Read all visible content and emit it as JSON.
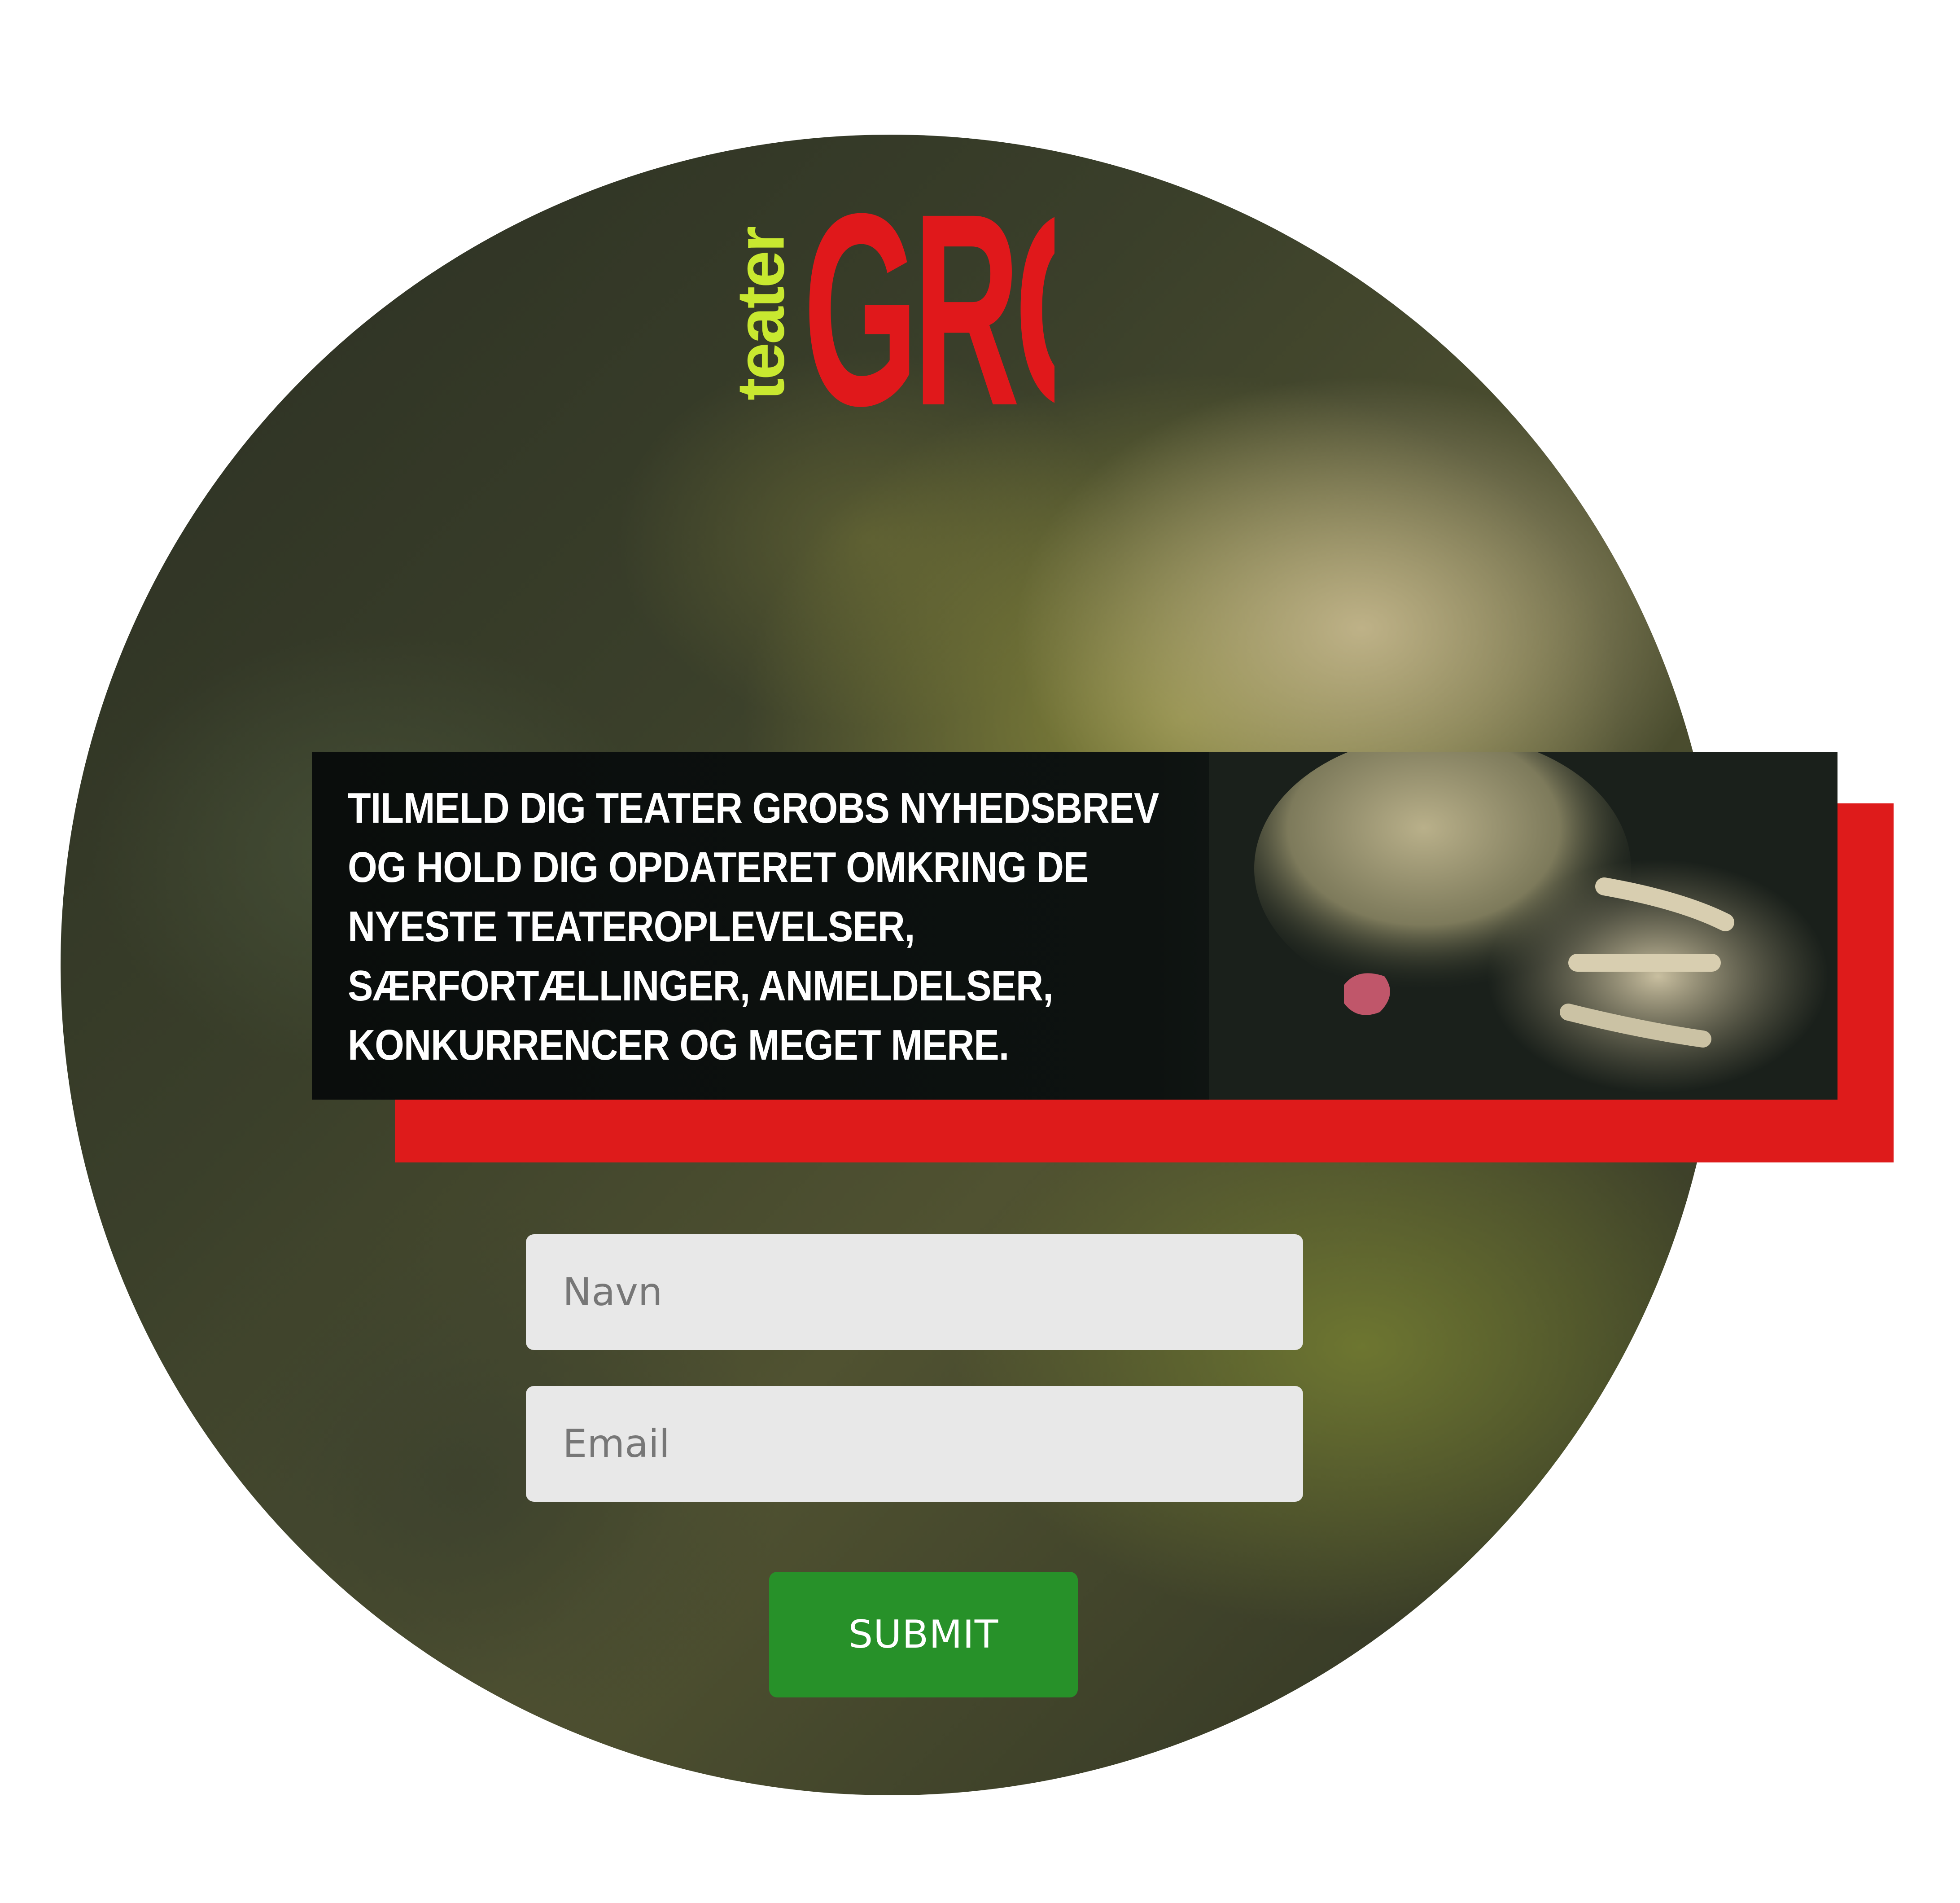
{
  "logo": {
    "small_word": "teater",
    "big_word": "GROB",
    "colors": {
      "small_word": "#c8e830",
      "big_word": "#e0181b"
    }
  },
  "banner": {
    "text": "Tilmeld dig Teater Grobs nyhedsbrev og hold dig opdateret omkring de nyeste teateroplevelser, særfortællinger, anmeldelser, konkurrencer og meget mere.",
    "accent_color": "#de1b1b"
  },
  "form": {
    "name_field": {
      "placeholder": "Navn",
      "value": ""
    },
    "email_field": {
      "placeholder": "Email",
      "value": ""
    },
    "submit_label": "SUBMIT",
    "submit_color": "#279129"
  }
}
